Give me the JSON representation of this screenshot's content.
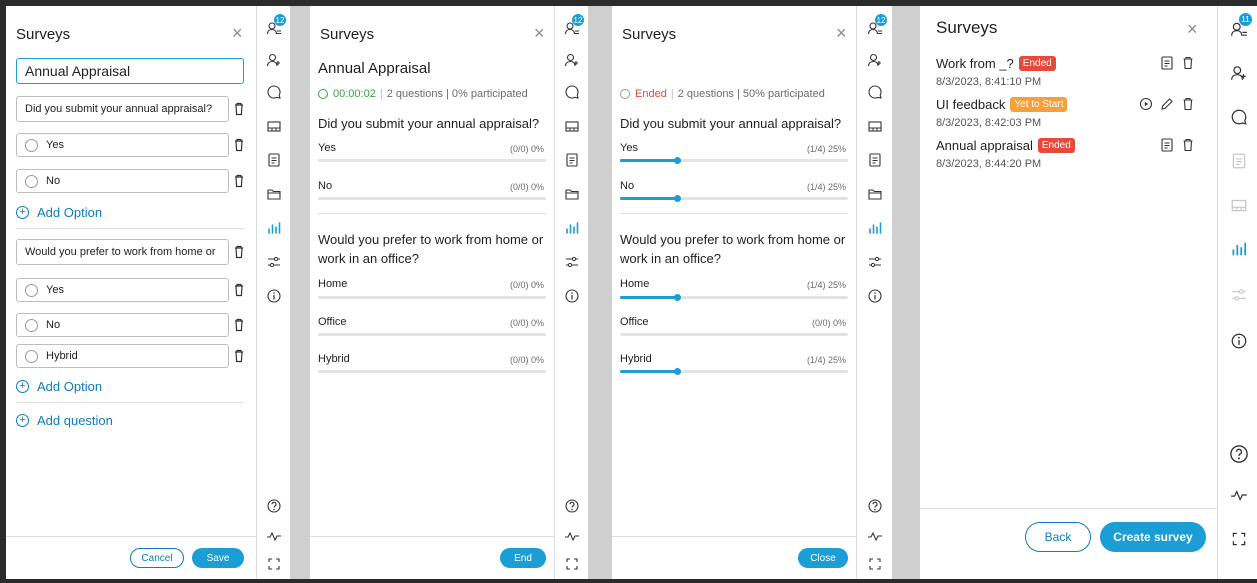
{
  "panel1": {
    "title": "Surveys",
    "survey_title": "Annual Appraisal",
    "questions": [
      {
        "text": "Did you submit your annual appraisal?",
        "options": [
          "Yes",
          "No"
        ]
      },
      {
        "text": "Would you prefer to work from home or",
        "options": [
          "Yes",
          "No",
          "Hybrid"
        ]
      }
    ],
    "add_option": "Add Option",
    "add_question": "Add question",
    "cancel": "Cancel",
    "save": "Save"
  },
  "panel2": {
    "title": "Surveys",
    "survey_title": "Annual Appraisal",
    "timer": "00:00:02",
    "meta": "2 questions | 0% participated",
    "questions": [
      {
        "text": "Did you submit your annual appraisal?",
        "options": [
          {
            "label": "Yes",
            "pct": "(0/0) 0%",
            "value": 0
          },
          {
            "label": "No",
            "pct": "(0/0) 0%",
            "value": 0
          }
        ]
      },
      {
        "text": "Would you prefer to work from home or work in an office?",
        "options": [
          {
            "label": "Home",
            "pct": "(0/0) 0%",
            "value": 0
          },
          {
            "label": "Office",
            "pct": "(0/0) 0%",
            "value": 0
          },
          {
            "label": "Hybrid",
            "pct": "(0/0) 0%",
            "value": 0
          }
        ]
      }
    ],
    "end": "End"
  },
  "panel3": {
    "title": "Surveys",
    "status": "Ended",
    "meta": "2 questions | 50% participated",
    "questions": [
      {
        "text": "Did you submit your annual appraisal?",
        "options": [
          {
            "label": "Yes",
            "pct": "(1/4) 25%",
            "value": 25
          },
          {
            "label": "No",
            "pct": "(1/4) 25%",
            "value": 25
          }
        ]
      },
      {
        "text": "Would you prefer to work from home or work in an office?",
        "options": [
          {
            "label": "Home",
            "pct": "(1/4) 25%",
            "value": 25
          },
          {
            "label": "Office",
            "pct": "(0/0) 0%",
            "value": 0
          },
          {
            "label": "Hybrid",
            "pct": "(1/4) 25%",
            "value": 25
          }
        ]
      }
    ],
    "close": "Close"
  },
  "panel4": {
    "title": "Surveys",
    "items": [
      {
        "name": "Work from _?",
        "status": "Ended",
        "date": "8/3/2023, 8:41:10 PM"
      },
      {
        "name": "UI feedback",
        "status": "Yet to Start",
        "date": "8/3/2023, 8:42:03 PM"
      },
      {
        "name": "Annual appraisal",
        "status": "Ended",
        "date": "8/3/2023, 8:44:20 PM"
      }
    ],
    "back": "Back",
    "create": "Create survey"
  },
  "rails": {
    "badge_a": "12",
    "badge_b": "12",
    "badge_c": "12",
    "badge_d": "11"
  },
  "colors": {
    "accent": "#1b9dd6",
    "ended": "#e64a3b",
    "yet_to_start": "#f5a03a",
    "timer": "#36a34a"
  }
}
